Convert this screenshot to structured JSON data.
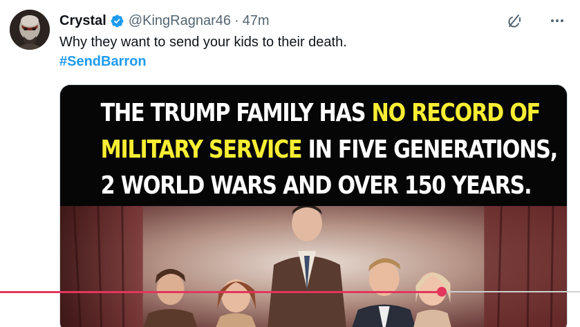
{
  "tweet": {
    "author_name": "Crystal",
    "handle": "@KingRagnar46",
    "separator": "·",
    "time": "47m",
    "text": "Why they want to send your kids to their death.",
    "hashtag": "#SendBarron"
  },
  "media": {
    "caption": {
      "line1_a": "THE TRUMP FAMILY HAS ",
      "line1_b": "NO RECORD OF",
      "line2_a": "MILITARY SERVICE",
      "line2_b": " IN FIVE GENERATIONS,",
      "line3": "2 WORLD WARS AND OVER 150 YEARS."
    },
    "highlight_color": "#f7ee34"
  },
  "icons": {
    "avatar": "avatar",
    "verified": "verified-badge-icon",
    "grok": "grok-icon",
    "more": "more-options-icon"
  },
  "colors": {
    "link": "#1d9bf0",
    "secondary_text": "#536471",
    "progress": "#e2365c"
  },
  "playback": {
    "progress_fraction": 0.762
  }
}
